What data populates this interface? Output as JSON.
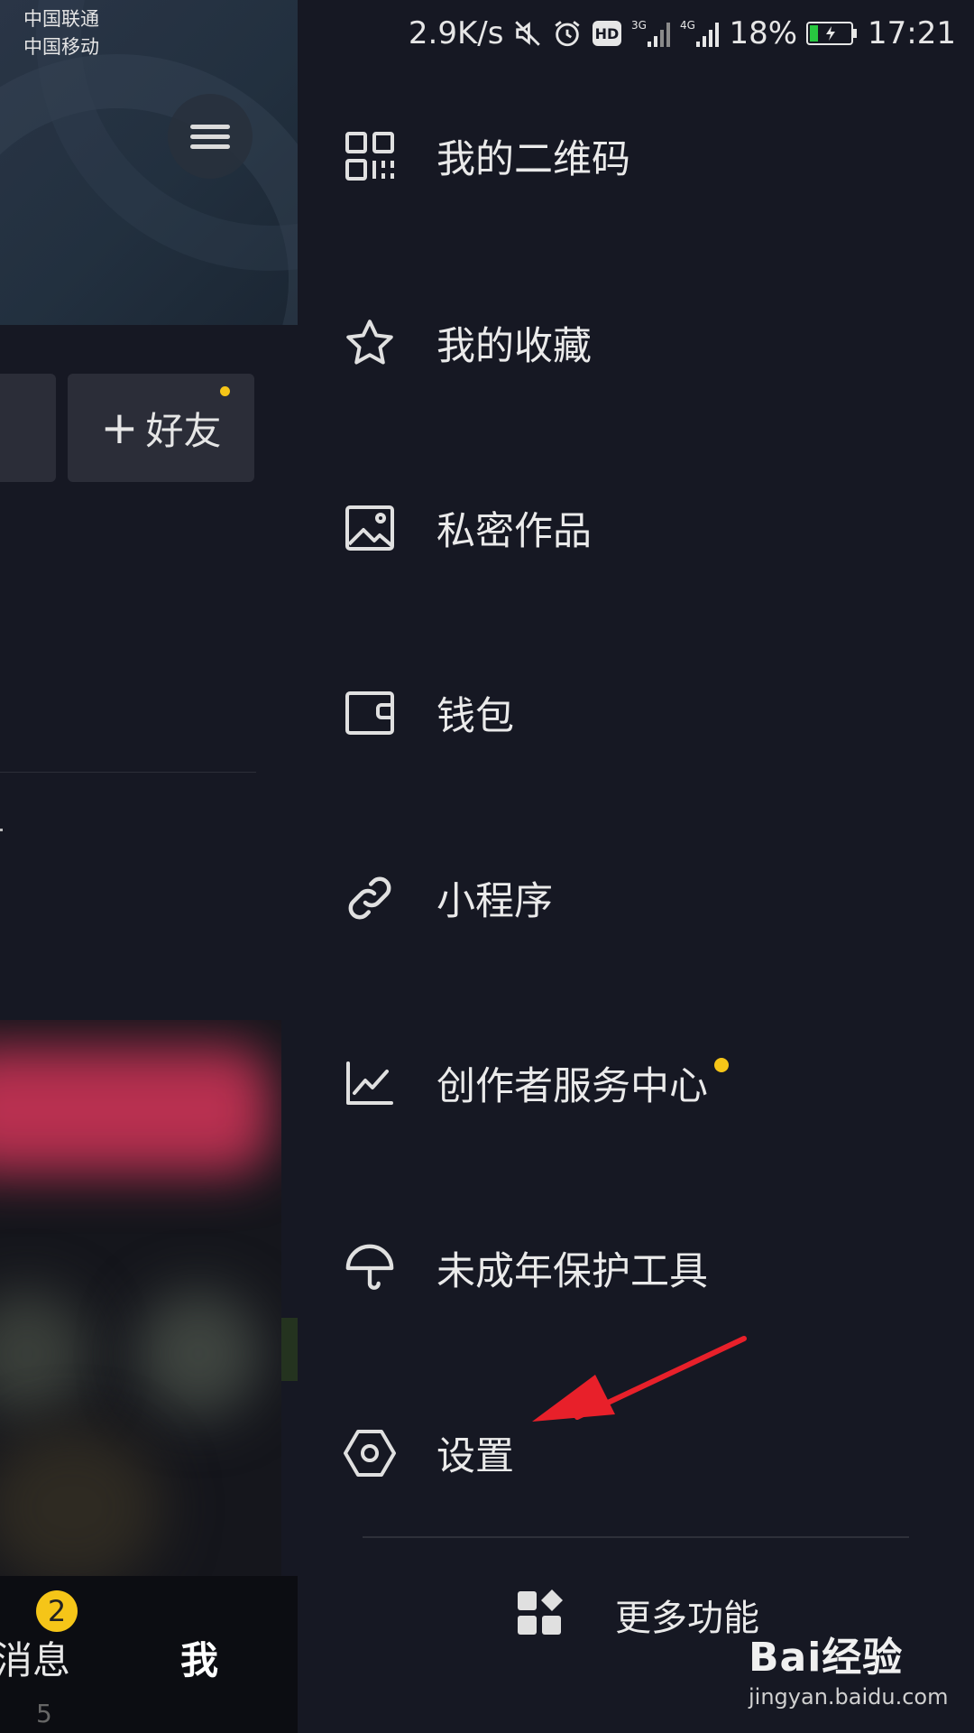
{
  "status_bar": {
    "carrier_1": "中国联通",
    "carrier_2": "中国移动",
    "speed": "2.9K/s",
    "network_3g": "3G",
    "network_4g": "4G",
    "battery": "18%",
    "time": "17:21",
    "hd_label": "HD"
  },
  "background_page": {
    "add_friend_label": "好友",
    "nav": {
      "messages": "消息",
      "messages_badge": "2",
      "me": "我"
    },
    "bottom_number": "5"
  },
  "drawer": {
    "items": [
      {
        "label": "我的二维码",
        "icon": "qr-code-icon"
      },
      {
        "label": "我的收藏",
        "icon": "star-icon"
      },
      {
        "label": "私密作品",
        "icon": "image-icon"
      },
      {
        "label": "钱包",
        "icon": "wallet-icon"
      },
      {
        "label": "小程序",
        "icon": "link-icon"
      },
      {
        "label": "创作者服务中心",
        "icon": "chart-icon"
      },
      {
        "label": "未成年保护工具",
        "icon": "umbrella-icon"
      },
      {
        "label": "设置",
        "icon": "hexagon-settings-icon"
      }
    ],
    "more_label": "更多功能"
  },
  "watermark": {
    "logo": "Bai经验",
    "url": "jingyan.baidu.com"
  },
  "colors": {
    "background": "#161823",
    "accent_dot": "#f5c518",
    "arrow": "#e8202a"
  }
}
